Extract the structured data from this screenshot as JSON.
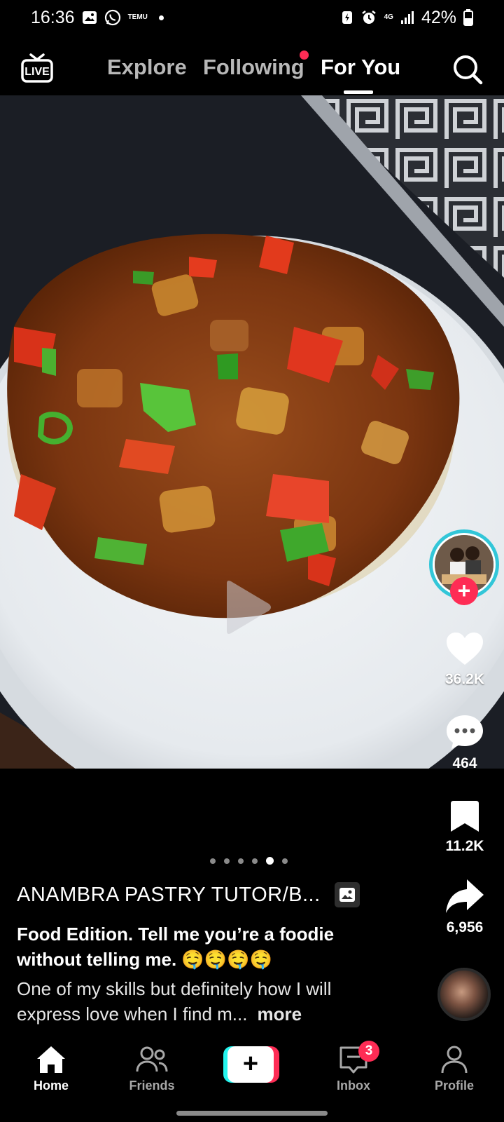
{
  "status_bar": {
    "time": "16:36",
    "notif_icons": [
      "gallery-icon",
      "whatsapp-icon",
      "temu-icon"
    ],
    "temu_text": "TEMU",
    "network": "4G",
    "battery": "42%"
  },
  "top_nav": {
    "live_label": "LIVE",
    "tabs": [
      "Explore",
      "Following",
      "For You"
    ],
    "active_tab": "For You",
    "following_has_dot": true
  },
  "actions": {
    "likes": "36.2K",
    "comments": "464",
    "saves": "11.2K",
    "shares": "6,956"
  },
  "carousel": {
    "total": 6,
    "active_index": 4
  },
  "post": {
    "author": "ANAMBRA PASTRY TUTOR/B...",
    "title": "Food Edition. Tell me you’re a foodie without telling me. 🤤🤤🤤🤤",
    "description": "One of my skills but definitely how I will express love when I find m...",
    "more_label": "more"
  },
  "bottom_nav": {
    "home": "Home",
    "friends": "Friends",
    "create_symbol": "+",
    "inbox": "Inbox",
    "inbox_badge": "3",
    "profile": "Profile",
    "active": "Home"
  },
  "colors": {
    "accent_red": "#fe2c55",
    "accent_cyan": "#25f4ee",
    "background": "#000000"
  }
}
